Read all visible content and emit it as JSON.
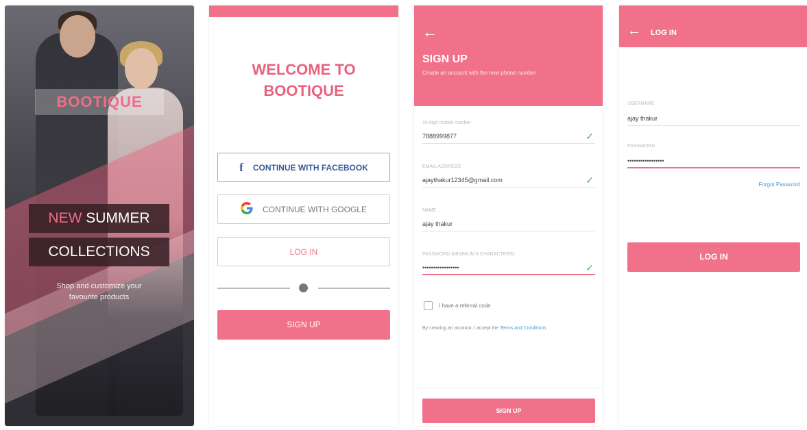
{
  "splash": {
    "brand": "BOOTIQUE",
    "headline_new": "NEW",
    "headline_summer": "SUMMER",
    "headline_collections": "COLLECTIONS",
    "tagline": "Shop and customize your favourite products"
  },
  "welcome": {
    "title_line1": "WELCOME TO",
    "title_line2": "BOOTIQUE",
    "facebook_label": "CONTINUE WITH FACEBOOK",
    "google_label": "CONTINUE WITH GOOGLE",
    "login_label": "LOG IN",
    "signup_label": "SIGN UP"
  },
  "signup": {
    "back_icon": "arrow-left-icon",
    "title": "SIGN UP",
    "subtitle": "Create an account with the new phone number",
    "fields": [
      {
        "label": "10 digit mobile number",
        "value": "7888999877"
      },
      {
        "label": "EMAIL ADDRESS",
        "value": "ajaythakur12345@gmail.com"
      },
      {
        "label": "NAME",
        "value": "ajay thakur"
      },
      {
        "label": "PASSWORD (MINIMUM 8 CHARACTERS)",
        "value": "•••••••••••••••••"
      }
    ],
    "referral_label": "I have a referral code",
    "terms_prefix": "By creating an account, I accept the",
    "terms_link": "Terms and Conditions",
    "signup_label": "SIGN UP"
  },
  "login": {
    "back_icon": "arrow-left-icon",
    "title": "LOG IN",
    "username_label": "USERNAME",
    "username_value": "ajay thakur",
    "password_label": "PASSWORD",
    "password_value": "•••••••••••••••••",
    "forgot_label": "Forgot Password",
    "login_label": "LOG IN"
  },
  "colors": {
    "accent": "#f2718a",
    "facebook": "#3b5998",
    "link": "#4a9ad0",
    "check": "#4caf50"
  }
}
